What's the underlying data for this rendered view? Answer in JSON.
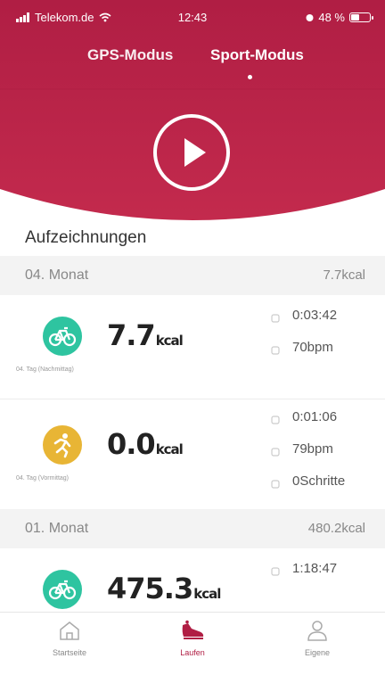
{
  "status_bar": {
    "carrier": "Telekom.de",
    "time": "12:43",
    "battery": "48 %",
    "battery_level": 0.48
  },
  "mode_tabs": {
    "gps_label": "GPS-Modus",
    "sport_label": "Sport-Modus",
    "active": "sport"
  },
  "section_title": "Aufzeichnungen",
  "months": [
    {
      "name": "04. Monat",
      "kcal": "7.7kcal",
      "records": [
        {
          "sport_icon": "bicycle-icon",
          "color": "#2ec4a0",
          "day": "04. Tag (Nachmittag)",
          "value": "7.7",
          "unit": "kcal",
          "stats": [
            "0:03:42",
            "70bpm"
          ]
        },
        {
          "sport_icon": "runner-icon",
          "color": "#e8b535",
          "day": "04. Tag (Vormittag)",
          "value": "0.0",
          "unit": "kcal",
          "stats": [
            "0:01:06",
            "79bpm",
            "0Schritte"
          ]
        }
      ]
    },
    {
      "name": "01. Monat",
      "kcal": "480.2kcal",
      "records": [
        {
          "sport_icon": "bicycle-icon",
          "color": "#2ec4a0",
          "day": "",
          "value": "475.3",
          "unit": "kcal",
          "stats": [
            "1:18:47"
          ]
        }
      ]
    }
  ],
  "bottom_tabs": [
    {
      "label": "Startseite",
      "icon": "home-icon",
      "active": false
    },
    {
      "label": "Laufen",
      "icon": "running-shoe-icon",
      "active": true
    },
    {
      "label": "Eigene",
      "icon": "person-icon",
      "active": false
    }
  ],
  "colors": {
    "accent": "#b01e44",
    "teal": "#2ec4a0",
    "amber": "#e8b535"
  }
}
